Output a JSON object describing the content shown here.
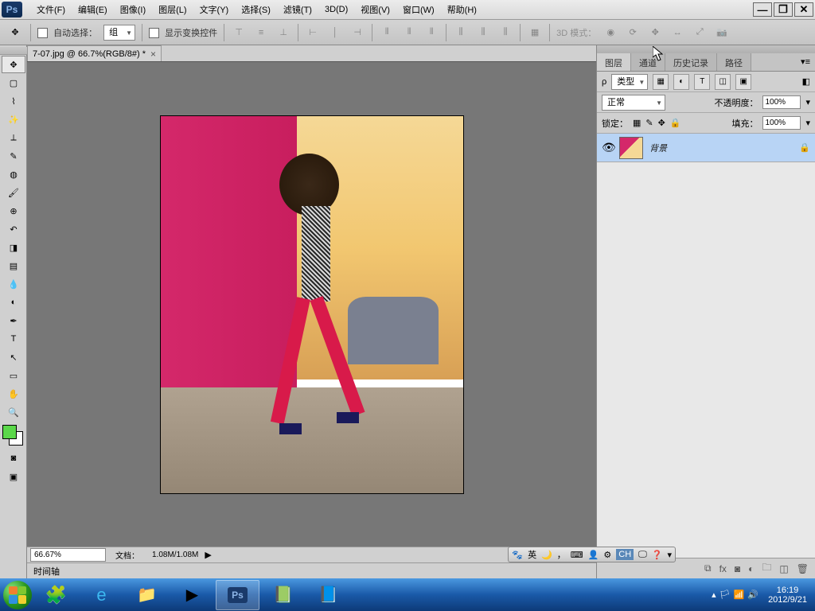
{
  "app": {
    "logo": "Ps"
  },
  "menu": {
    "items": [
      "文件(F)",
      "编辑(E)",
      "图像(I)",
      "图层(L)",
      "文字(Y)",
      "选择(S)",
      "滤镜(T)",
      "3D(D)",
      "视图(V)",
      "窗口(W)",
      "帮助(H)"
    ]
  },
  "window_controls": {
    "min": "—",
    "max": "❐",
    "close": "✕"
  },
  "options": {
    "auto_select": "自动选择：",
    "group": "组",
    "show_transform": "显示变换控件",
    "mode_3d": "3D 模式："
  },
  "document": {
    "tab": "7-07.jpg @ 66.7%(RGB/8#) *",
    "zoom": "66.67%",
    "info_label": "文档：",
    "info": "1.08M/1.08M",
    "timeline": "时间轴"
  },
  "panels": {
    "tabs": [
      "图层",
      "通道",
      "历史记录",
      "路径"
    ],
    "filter_kind": "类型",
    "blend_mode": "正常",
    "opacity_label": "不透明度：",
    "opacity": "100%",
    "lock_label": "锁定：",
    "fill_label": "填充：",
    "fill": "100%",
    "layer_name": "背景"
  },
  "ime": {
    "lang": "英",
    "ch": "CH"
  },
  "taskbar": {
    "time": "16:19",
    "date": "2012/9/21"
  }
}
